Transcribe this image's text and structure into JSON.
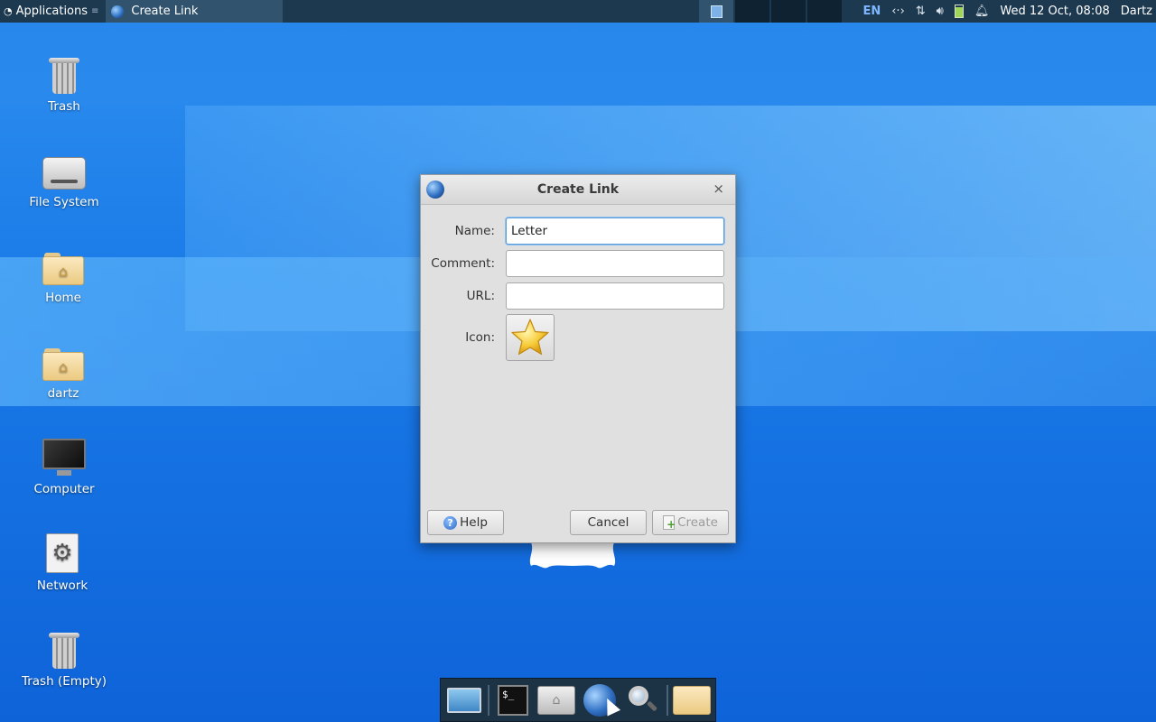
{
  "top_panel": {
    "apps_label": "Applications",
    "active_task": "Create Link",
    "keyboard_layout": "EN",
    "datetime": "Wed 12 Oct, 08:08",
    "user": "Dartz"
  },
  "desktop_icons": [
    {
      "label": "Trash",
      "icon": "trash-icon"
    },
    {
      "label": "File System",
      "icon": "drive-icon"
    },
    {
      "label": "Home",
      "icon": "home-folder-icon"
    },
    {
      "label": "dartz",
      "icon": "home-folder-icon"
    },
    {
      "label": "Computer",
      "icon": "monitor-icon"
    },
    {
      "label": "Network",
      "icon": "network-icon"
    },
    {
      "label": "Trash (Empty)",
      "icon": "trash-icon"
    }
  ],
  "dialog": {
    "title": "Create Link",
    "close_glyph": "×",
    "fields": {
      "name_label": "Name:",
      "name_value": "Letter",
      "comment_label": "Comment:",
      "comment_value": "",
      "url_label": "URL:",
      "url_value": "",
      "icon_label": "Icon:"
    },
    "buttons": {
      "help": "Help",
      "cancel": "Cancel",
      "create": "Create"
    }
  },
  "dock": {
    "items": [
      "show-desktop-icon",
      "terminal-icon",
      "file-manager-icon",
      "web-browser-icon",
      "app-finder-icon",
      "folder-icon"
    ]
  },
  "colors": {
    "panel_bg": "#1d3950",
    "desktop_blue": "#1a7be8",
    "dialog_bg": "#e0e0e0",
    "focus_blue": "#5a9bdc"
  }
}
